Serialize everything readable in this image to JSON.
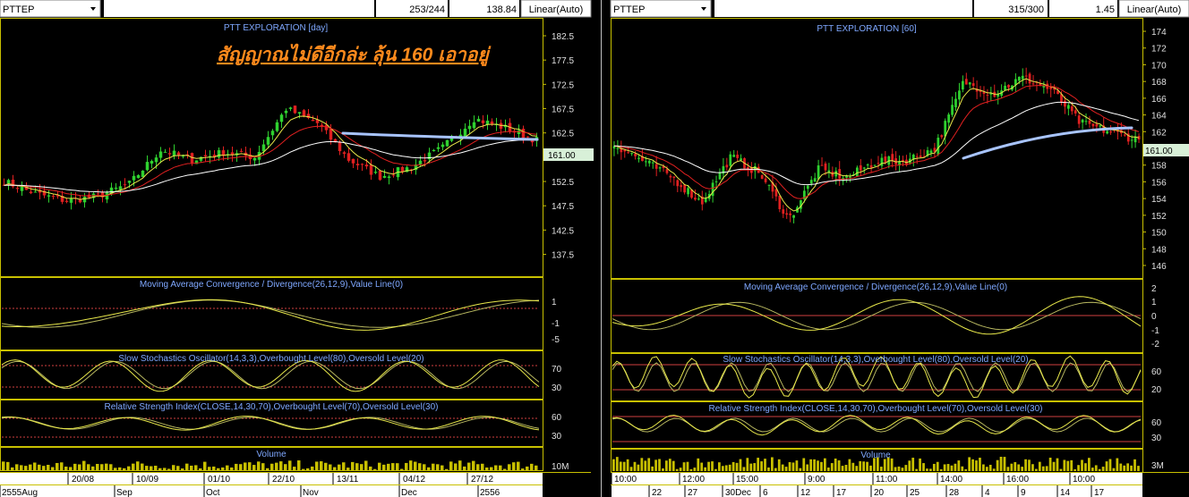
{
  "left": {
    "symbol": "PTTEP",
    "count": "253/244",
    "last_value": "138.84",
    "scale_mode": "Linear(Auto)",
    "title": "PTT EXPLORATION [day]",
    "annotation": "สัญญาณไม่ดีอีกล่ะ ลุ้น 160 เอาอยู่",
    "price_badge": "161.00",
    "macd_title": "Moving Average Convergence / Divergence(26,12,9),Value Line(0)",
    "stoch_title": "Slow Stochastics Oscillator(14,3,3),Overbought Level(80),Oversold Level(20)",
    "rsi_title": "Relative Strength Index(CLOSE,14,30,70),Overbought Level(70),Oversold Level(30)",
    "vol_title": "Volume",
    "vol_scale": "10M",
    "date_row1": [
      "20/08",
      "10/09",
      "01/10",
      "22/10",
      "13/11",
      "04/12",
      "27/12"
    ],
    "date_row2": [
      "2555Aug",
      "Sep",
      "Oct",
      "Nov",
      "Dec",
      "2556"
    ]
  },
  "right": {
    "symbol": "PTTEP",
    "count": "315/300",
    "last_value": "1.45",
    "scale_mode": "Linear(Auto)",
    "title": "PTT EXPLORATION [60]",
    "price_badge": "161.00",
    "macd_title": "Moving Average Convergence / Divergence(26,12,9),Value Line(0)",
    "stoch_title": "Slow Stochastics Oscillator(14,3,3),Overbought Level(80),Oversold Level(20)",
    "rsi_title": "Relative Strength Index(CLOSE,14,30,70),Overbought Level(70),Oversold Level(30)",
    "vol_title": "Volume",
    "vol_scale": "3M",
    "time_row1": [
      "10:00",
      "12:00",
      "15:00",
      "9:00",
      "11:00",
      "14:00",
      "16:00",
      "10:00"
    ],
    "time_row2": [
      "22",
      "27",
      "30Dec",
      "6",
      "12",
      "17",
      "20",
      "25",
      "28",
      "4",
      "9",
      "14",
      "17"
    ]
  },
  "colors": {
    "up": "#2fd12f",
    "down": "#e02020",
    "ema_fast": "#e8e84a",
    "ema_mid": "#e02020",
    "ema_slow": "#ffffff",
    "trend": "#a8c4ff",
    "panel_border": "#c8c000",
    "axis_text": "#e0e0e0",
    "title_text": "#7fa8ff",
    "annotation": "#ff8a1c"
  },
  "chart_data": [
    {
      "type": "line",
      "title": "PTT EXPLORATION [day]",
      "x": [
        "20/08",
        "10/09",
        "01/10",
        "22/10",
        "13/11",
        "04/12",
        "27/12"
      ],
      "yticks": [
        137.5,
        142.5,
        147.5,
        152.5,
        157.5,
        162.5,
        167.5,
        172.5,
        177.5,
        182.5
      ],
      "ylim": [
        133,
        186
      ],
      "series": [
        {
          "values": [
            152.5,
            150,
            148.5,
            149.5,
            152,
            159,
            157,
            158.5,
            157.5,
            167.5,
            164.5,
            157,
            153.5,
            155.5,
            159.5,
            165.5,
            163.5,
            161
          ]
        }
      ],
      "macd_yticks": [
        1,
        -1,
        -5
      ],
      "stoch_yticks": [
        70,
        30
      ],
      "rsi_yticks": [
        60,
        30
      ],
      "volume_label": "10M"
    },
    {
      "type": "line",
      "title": "PTT EXPLORATION [60]",
      "x": [
        "10:00",
        "12:00",
        "15:00",
        "9:00",
        "11:00",
        "14:00",
        "16:00",
        "10:00"
      ],
      "yticks": [
        146,
        148,
        150,
        152,
        154,
        156,
        158,
        160,
        162,
        164,
        166,
        168,
        170,
        172,
        174
      ],
      "ylim": [
        144.5,
        175.5
      ],
      "series": [
        {
          "values": [
            160.5,
            158.5,
            156.5,
            153.5,
            159,
            157,
            151.5,
            157.5,
            156.5,
            158.5,
            158.5,
            160,
            168,
            166.5,
            168.5,
            167,
            163,
            162,
            161
          ]
        }
      ],
      "macd_yticks": [
        2,
        1,
        0,
        -1,
        -2
      ],
      "stoch_yticks": [
        60,
        20
      ],
      "rsi_yticks": [
        60,
        30
      ],
      "volume_label": "3M"
    }
  ]
}
